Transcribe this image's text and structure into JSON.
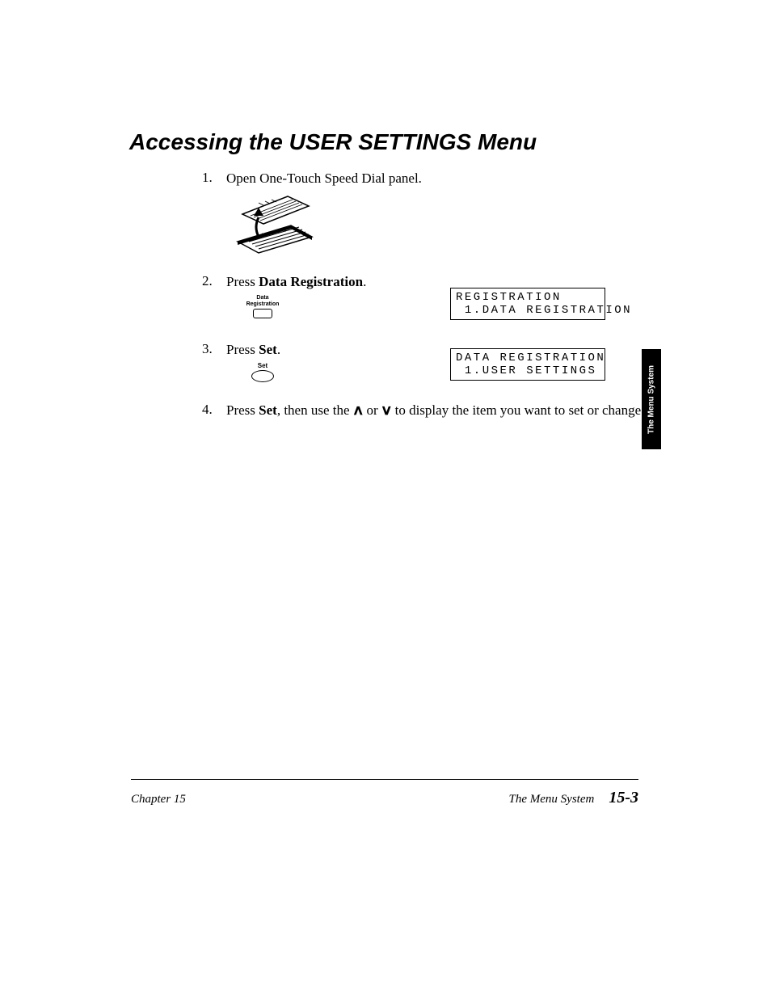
{
  "heading": "Accessing the USER SETTINGS Menu",
  "steps": {
    "s1": {
      "num": "1.",
      "text": "Open One-Touch Speed Dial panel."
    },
    "s2": {
      "num": "2.",
      "pre": "Press ",
      "bold": "Data Registration",
      "post": "."
    },
    "s3": {
      "num": "3.",
      "pre": "Press ",
      "bold": "Set",
      "post": "."
    },
    "s4": {
      "num": "4.",
      "pre": "Press ",
      "bold": "Set",
      "mid": ", then use the ",
      "arrow_up": "∧",
      "or": " or ",
      "arrow_down": "∨",
      "post": " to display the item you want to set or change."
    }
  },
  "buttons": {
    "data_reg_line1": "Data",
    "data_reg_line2": "Registration",
    "set": "Set"
  },
  "lcd1": {
    "line1": "REGISTRATION",
    "line2": " 1.DATA REGISTRATION"
  },
  "lcd2": {
    "line1": "DATA REGISTRATION",
    "line2": " 1.USER SETTINGS"
  },
  "side_tab": "The Menu System",
  "footer": {
    "chapter": "Chapter 15",
    "section": "The Menu System",
    "page": "15-3"
  }
}
